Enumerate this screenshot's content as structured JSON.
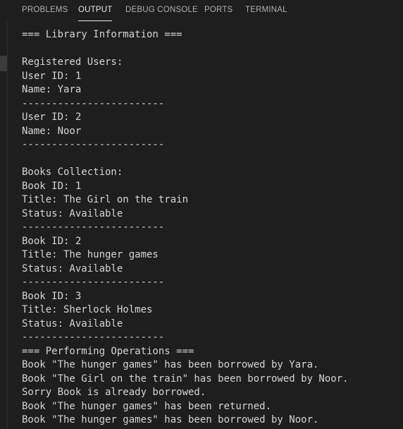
{
  "tabs": [
    {
      "label": "PROBLEMS",
      "active": false
    },
    {
      "label": "OUTPUT",
      "active": true
    },
    {
      "label": "DEBUG CONSOLE",
      "active": false
    },
    {
      "label": "PORTS",
      "active": false
    },
    {
      "label": "TERMINAL",
      "active": false
    }
  ],
  "output_lines": [
    "=== Library Information ===",
    "",
    "Registered Users:",
    "User ID: 1",
    "Name: Yara",
    "------------------------",
    "User ID: 2",
    "Name: Noor",
    "------------------------",
    "",
    "Books Collection:",
    "Book ID: 1",
    "Title: The Girl on the train",
    "Status: Available",
    "------------------------",
    "Book ID: 2",
    "Title: The hunger games",
    "Status: Available",
    "------------------------",
    "Book ID: 3",
    "Title: Sherlock Holmes",
    "Status: Available",
    "------------------------",
    "=== Performing Operations ===",
    "Book \"The hunger games\" has been borrowed by Yara.",
    "Book \"The Girl on the train\" has been borrowed by Noor.",
    "Sorry Book is already borrowed.",
    "Book \"The hunger games\" has been returned.",
    "Book \"The hunger games\" has been borrowed by Noor."
  ],
  "colors": {
    "background": "#1e1e1e",
    "text": "#d4d4d4",
    "tab_inactive": "#b0b0b0",
    "tab_active": "#e7e7e7"
  }
}
